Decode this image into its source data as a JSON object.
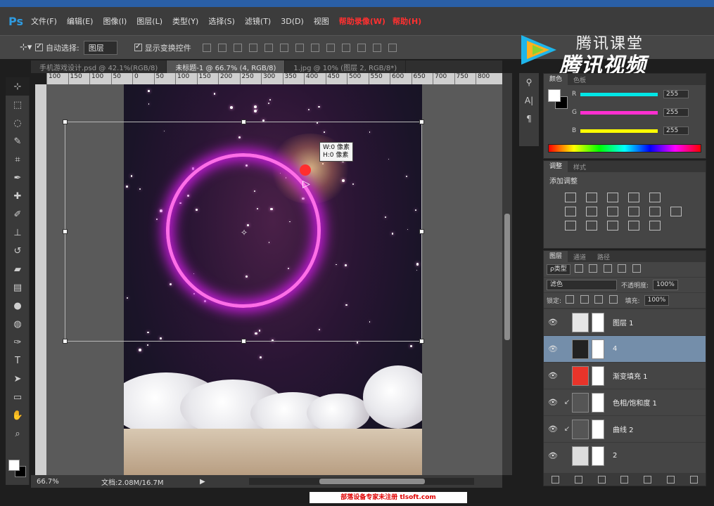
{
  "menubar": {
    "logo": "Ps",
    "items": [
      "文件(F)",
      "编辑(E)",
      "图像(I)",
      "图层(L)",
      "类型(Y)",
      "选择(S)",
      "滤镜(T)",
      "3D(D)",
      "视图"
    ],
    "red_items": [
      "帮助录像(W)",
      "帮助(H)"
    ]
  },
  "options_bar": {
    "auto_select_label": "自动选择:",
    "auto_select_value": "图层",
    "show_transform_label": "显示变换控件"
  },
  "brand": {
    "line1": "腾讯课堂",
    "line2": "腾讯视频"
  },
  "doc_tabs": [
    {
      "label": "手机游戏设计.psd @ 42.1%(RGB/8)",
      "active": false
    },
    {
      "label": "未标题-1 @ 66.7% (4, RGB/8)",
      "active": true
    },
    {
      "label": "1.jpg @ 10% (图层 2, RGB/8*)",
      "active": false
    }
  ],
  "ruler_ticks": [
    "100",
    "150",
    "100",
    "50",
    "0",
    "50",
    "100",
    "150",
    "200",
    "250",
    "300",
    "350",
    "400",
    "450",
    "500",
    "550",
    "600",
    "650",
    "700",
    "750",
    "800"
  ],
  "canvas": {
    "tooltip_line1": "W:0 像素",
    "tooltip_line2": "H:0 像素"
  },
  "status": {
    "zoom": "66.7%",
    "doc": "文档:2.08M/16.7M"
  },
  "color_panel": {
    "tabs": [
      "颜色",
      "色板"
    ],
    "channels": [
      {
        "label": "R",
        "value": "255",
        "color": "#00e6e6"
      },
      {
        "label": "G",
        "value": "255",
        "color": "#ff2fd0"
      },
      {
        "label": "B",
        "value": "255",
        "color": "#ffff00"
      }
    ]
  },
  "adjustments_panel": {
    "tabs": [
      "调整",
      "样式"
    ],
    "title": "添加调整"
  },
  "layers_panel": {
    "tabs": [
      "图层",
      "通道",
      "路径"
    ],
    "filter_label": "ρ类型",
    "blend_mode": "滤色",
    "opacity_label": "不透明度:",
    "opacity_value": "100%",
    "lock_label": "锁定:",
    "fill_label": "填充:",
    "fill_value": "100%",
    "layers": [
      {
        "name": "图层 1",
        "selected": false,
        "thumb": "#e6e6e6",
        "linked": false
      },
      {
        "name": "4",
        "selected": true,
        "thumb": "#222222",
        "linked": false
      },
      {
        "name": "渐变填充 1",
        "selected": false,
        "thumb": "#e8342a",
        "linked": false
      },
      {
        "name": "色相/饱和度 1",
        "selected": false,
        "thumb": "#555555",
        "linked": true
      },
      {
        "name": "曲线 2",
        "selected": false,
        "thumb": "#555555",
        "linked": true
      },
      {
        "name": "2",
        "selected": false,
        "thumb": "#dddddd",
        "linked": false
      }
    ]
  },
  "bottom_banner": "部落设备专家未注册 tlsoft.com"
}
